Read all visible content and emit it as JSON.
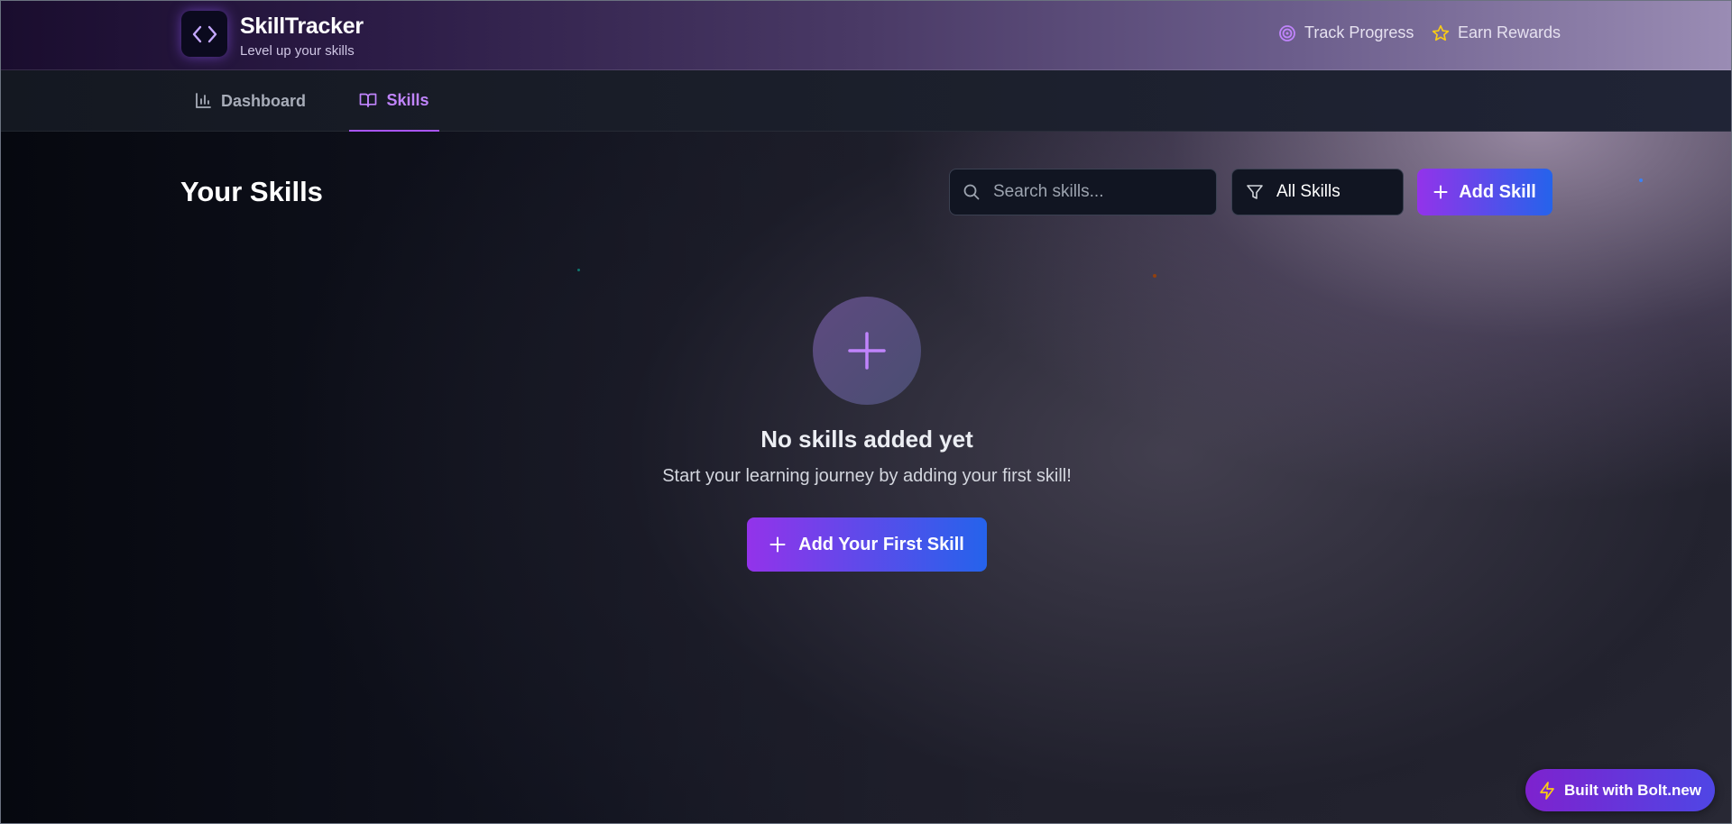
{
  "header": {
    "app_title": "SkillTracker",
    "app_subtitle": "Level up your skills",
    "links": [
      {
        "label": "Track Progress",
        "icon": "target-icon"
      },
      {
        "label": "Earn Rewards",
        "icon": "star-icon"
      }
    ]
  },
  "nav": {
    "tabs": [
      {
        "label": "Dashboard",
        "icon": "bar-chart-icon",
        "active": false
      },
      {
        "label": "Skills",
        "icon": "book-open-icon",
        "active": true
      }
    ]
  },
  "main": {
    "title": "Your Skills",
    "search": {
      "placeholder": "Search skills...",
      "value": ""
    },
    "filter": {
      "selected": "All Skills"
    },
    "add_button": "Add Skill",
    "empty_state": {
      "title": "No skills added yet",
      "subtitle": "Start your learning journey by adding your first skill!",
      "button": "Add Your First Skill"
    }
  },
  "badge": {
    "label": "Built with Bolt.new"
  },
  "colors": {
    "accent_purple": "#a855f7",
    "gradient_start": "#9333ea",
    "gradient_end": "#2563eb",
    "star_yellow": "#facc15"
  }
}
